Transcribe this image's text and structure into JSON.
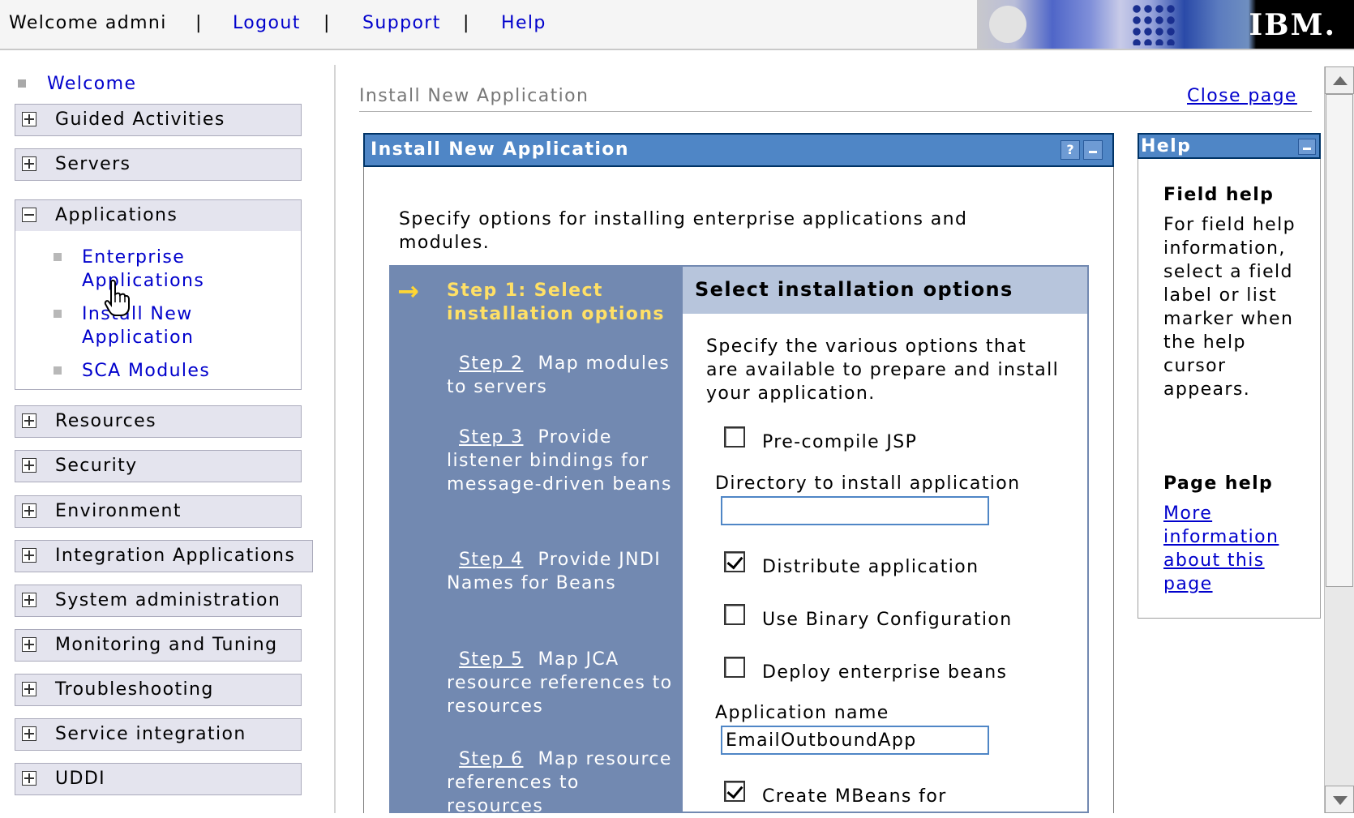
{
  "topbar": {
    "welcome": "Welcome admni",
    "separator": "|",
    "links": [
      "Logout",
      "Support",
      "Help"
    ],
    "brand": "IBM."
  },
  "nav": {
    "welcome": "Welcome",
    "groups": [
      {
        "label": "Guided Activities",
        "expanded": false
      },
      {
        "label": "Servers",
        "expanded": false
      },
      {
        "label": "Applications",
        "expanded": true
      },
      {
        "label": "Resources",
        "expanded": false
      },
      {
        "label": "Security",
        "expanded": false
      },
      {
        "label": "Environment",
        "expanded": false
      },
      {
        "label": "Integration Applications",
        "expanded": false
      },
      {
        "label": "System administration",
        "expanded": false
      },
      {
        "label": "Monitoring and Tuning",
        "expanded": false
      },
      {
        "label": "Troubleshooting",
        "expanded": false
      },
      {
        "label": "Service integration",
        "expanded": false
      },
      {
        "label": "UDDI",
        "expanded": false
      }
    ],
    "applications_items": [
      "Enterprise Applications",
      "Install New Application",
      "SCA Modules"
    ]
  },
  "page": {
    "title": "Install New Application",
    "close": "Close page"
  },
  "panel": {
    "title": "Install New Application",
    "help_btn": "?",
    "intro": "Specify options for installing enterprise applications and modules."
  },
  "wizard": {
    "current_step": "Step 1: Select installation options",
    "steps": [
      {
        "link": "Step 2",
        "text": "Map modules to servers"
      },
      {
        "link": "Step 3",
        "text": "Provide listener bindings for message-driven beans"
      },
      {
        "link": "Step 4",
        "text": "Provide JNDI Names for Beans"
      },
      {
        "link": "Step 5",
        "text": "Map JCA resource references to resources"
      },
      {
        "link": "Step 6",
        "text": "Map resource references to resources"
      }
    ],
    "section_title": "Select installation options",
    "description": "Specify the various options that are available to prepare and install your application.",
    "options": {
      "precompile_jsp": {
        "label": "Pre-compile JSP",
        "checked": false
      },
      "directory_label": "Directory to install application",
      "directory_value": "",
      "distribute": {
        "label": "Distribute application",
        "checked": true
      },
      "binary_config": {
        "label": "Use Binary Configuration",
        "checked": false
      },
      "deploy_ejb": {
        "label": "Deploy enterprise beans",
        "checked": false
      },
      "app_name_label": "Application name",
      "app_name_value": "EmailOutboundApp",
      "create_mbeans": {
        "label": "Create MBeans for",
        "checked": true
      }
    }
  },
  "help": {
    "title": "Help",
    "field_help_title": "Field help",
    "field_help_text": "For field help information, select a field label or list marker when the help cursor appears.",
    "page_help_title": "Page help",
    "page_help_link": "More information about this page"
  },
  "colors": {
    "panel_header": "#4f86c6",
    "wizard_steps_bg": "#7289b1",
    "current_step": "#ffe066",
    "link": "#0000cc"
  }
}
